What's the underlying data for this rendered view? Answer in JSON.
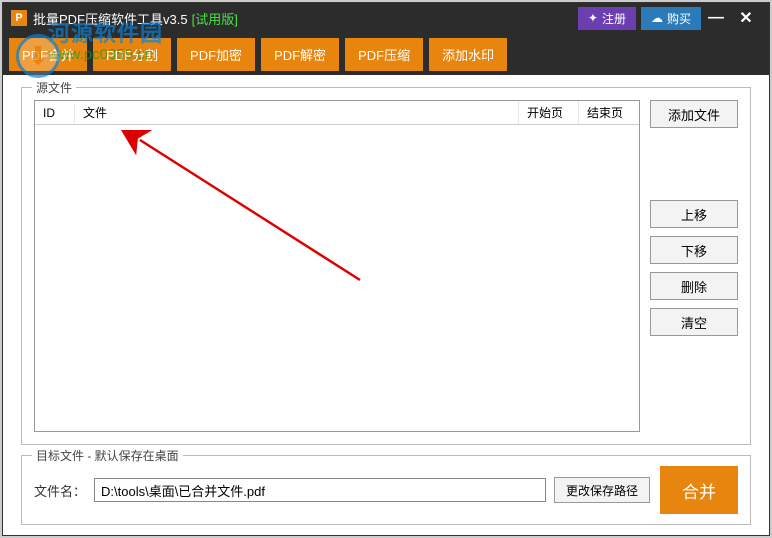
{
  "titlebar": {
    "title": "批量PDF压缩软件工具v3.5",
    "trial": "[试用版]",
    "register": "注册",
    "buy": "购买"
  },
  "tabs": [
    "PDF合并",
    "PDF分割",
    "PDF加密",
    "PDF解密",
    "PDF压缩",
    "添加水印"
  ],
  "source": {
    "groupTitle": "源文件",
    "columns": {
      "id": "ID",
      "file": "文件",
      "start": "开始页",
      "end": "结束页"
    },
    "buttons": {
      "add": "添加文件",
      "up": "上移",
      "down": "下移",
      "delete": "删除",
      "clear": "清空"
    }
  },
  "target": {
    "groupTitle": "目标文件 - 默认保存在桌面",
    "filenameLabel": "文件名：",
    "path": "D:\\tools\\桌面\\已合并文件.pdf",
    "changePath": "更改保存路径",
    "merge": "合并"
  },
  "watermark": {
    "text": "河源软件园",
    "url": "www.pc0359.cn"
  }
}
